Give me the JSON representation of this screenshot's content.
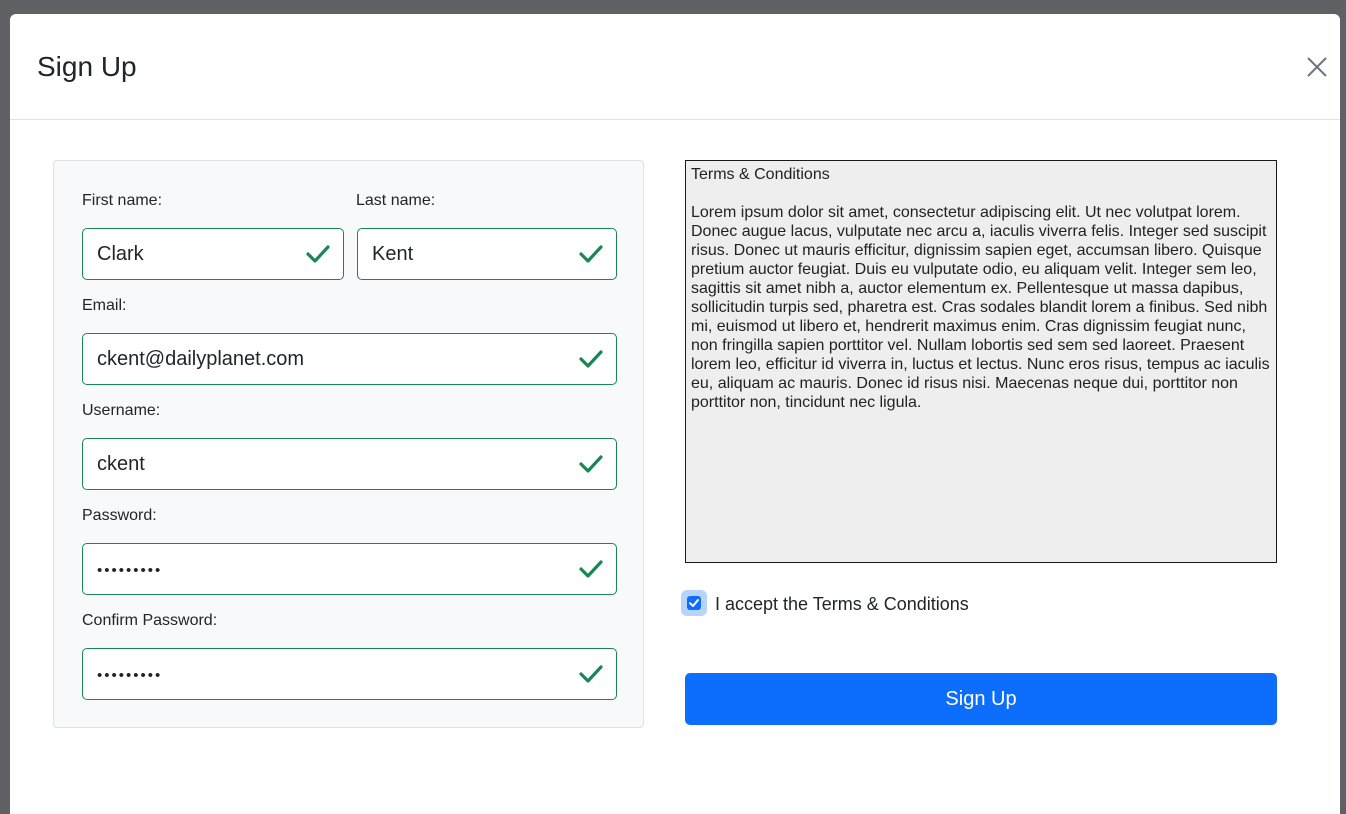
{
  "modal": {
    "title": "Sign Up",
    "close_icon": "close-icon"
  },
  "form": {
    "first_name": {
      "label": "First name:",
      "value": "Clark"
    },
    "last_name": {
      "label": "Last name:",
      "value": "Kent"
    },
    "email": {
      "label": "Email:",
      "value": "ckent@dailyplanet.com"
    },
    "username": {
      "label": "Username:",
      "value": "ckent"
    },
    "password": {
      "label": "Password:",
      "value": "•••••••••"
    },
    "confirm_password": {
      "label": "Confirm Password:",
      "value": "•••••••••"
    },
    "valid_icon": "check-icon"
  },
  "terms": {
    "title": "Terms & Conditions",
    "body": "Lorem ipsum dolor sit amet, consectetur adipiscing elit. Ut nec volutpat lorem. Donec augue lacus, vulputate nec arcu a, iaculis viverra felis. Integer sed suscipit risus. Donec ut mauris efficitur, dignissim sapien eget, accumsan libero. Quisque pretium auctor feugiat. Duis eu vulputate odio, eu aliquam velit. Integer sem leo, sagittis sit amet nibh a, auctor elementum ex. Pellentesque ut massa dapibus, sollicitudin turpis sed, pharetra est. Cras sodales blandit lorem a finibus. Sed nibh mi, euismod ut libero et, hendrerit maximus enim. Cras dignissim feugiat nunc, non fringilla sapien porttitor vel. Nullam lobortis sed sem sed laoreet. Praesent lorem leo, efficitur id viverra in, luctus et lectus. Nunc eros risus, tempus ac iaculis eu, aliquam ac mauris. Donec id risus nisi. Maecenas neque dui, porttitor non porttitor non, tincidunt nec ligula.",
    "accept_label": "I accept the Terms & Conditions",
    "accepted": true
  },
  "submit": {
    "label": "Sign Up"
  },
  "colors": {
    "primary": "#0d6efd",
    "valid": "#198754",
    "backdrop": "#5f6165"
  }
}
